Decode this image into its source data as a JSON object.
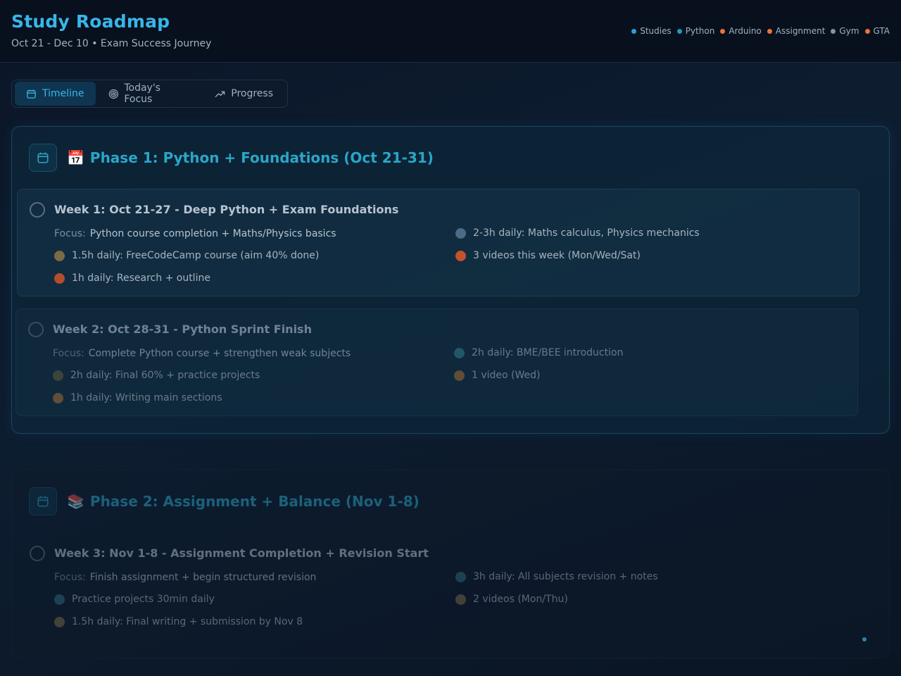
{
  "header": {
    "title": "Study Roadmap",
    "subtitle": "Oct 21 - Dec 10 • Exam Success Journey",
    "legend": [
      {
        "label": "Studies",
        "color": "#2d9fd6"
      },
      {
        "label": "Python",
        "color": "#1f9bb8"
      },
      {
        "label": "Arduino",
        "color": "#e8743b"
      },
      {
        "label": "Assignment",
        "color": "#e8743b"
      },
      {
        "label": "Gym",
        "color": "#8a929c"
      },
      {
        "label": "GTA",
        "color": "#e8743b"
      }
    ]
  },
  "tabs": [
    {
      "label": "Timeline",
      "icon": "calendar-icon",
      "active": true
    },
    {
      "label": "Today's Focus",
      "icon": "target-icon",
      "active": false
    },
    {
      "label": "Progress",
      "icon": "trending-up-icon",
      "active": false
    }
  ],
  "phases": [
    {
      "emoji": "📅",
      "title": "Phase 1: Python + Foundations (Oct 21-31)",
      "weeks": [
        {
          "title": "Week 1: Oct 21-27 - Deep Python + Exam Foundations",
          "focus_label": "Focus:",
          "focus": "Python course completion + Maths/Physics basics",
          "tasks": [
            {
              "text": "2-3h daily: Maths calculus, Physics mechanics",
              "color": "#4b6a86"
            },
            {
              "text": "1.5h daily: FreeCodeCamp course (aim 40% done)",
              "color": "#7a6a45"
            },
            {
              "text": "3 videos this week (Mon/Wed/Sat)",
              "color": "#c2532c"
            },
            {
              "text": "1h daily: Research + outline",
              "color": "#b24d2e"
            }
          ]
        },
        {
          "title": "Week 2: Oct 28-31 - Python Sprint Finish",
          "focus_label": "Focus:",
          "focus": "Complete Python course + strengthen weak subjects",
          "tasks": [
            {
              "text": "2h daily: BME/BEE introduction",
              "color": "#2f7a8a"
            },
            {
              "text": "2h daily: Final 60% + practice projects",
              "color": "#5f5a3f"
            },
            {
              "text": "1 video (Wed)",
              "color": "#9a6a3a"
            },
            {
              "text": "1h daily: Writing main sections",
              "color": "#9a6a3a"
            }
          ]
        }
      ]
    },
    {
      "emoji": "📚",
      "title": "Phase 2: Assignment + Balance (Nov 1-8)",
      "weeks": [
        {
          "title": "Week 3: Nov 1-8 - Assignment Completion + Revision Start",
          "focus_label": "Focus:",
          "focus": "Finish assignment + begin structured revision",
          "tasks": [
            {
              "text": "3h daily: All subjects revision + notes",
              "color": "#2f6a7a"
            },
            {
              "text": "Practice projects 30min daily",
              "color": "#2f6a7a"
            },
            {
              "text": "2 videos (Mon/Thu)",
              "color": "#7a6a45"
            },
            {
              "text": "1.5h daily: Final writing + submission by Nov 8",
              "color": "#7a6a45"
            }
          ]
        }
      ]
    }
  ]
}
